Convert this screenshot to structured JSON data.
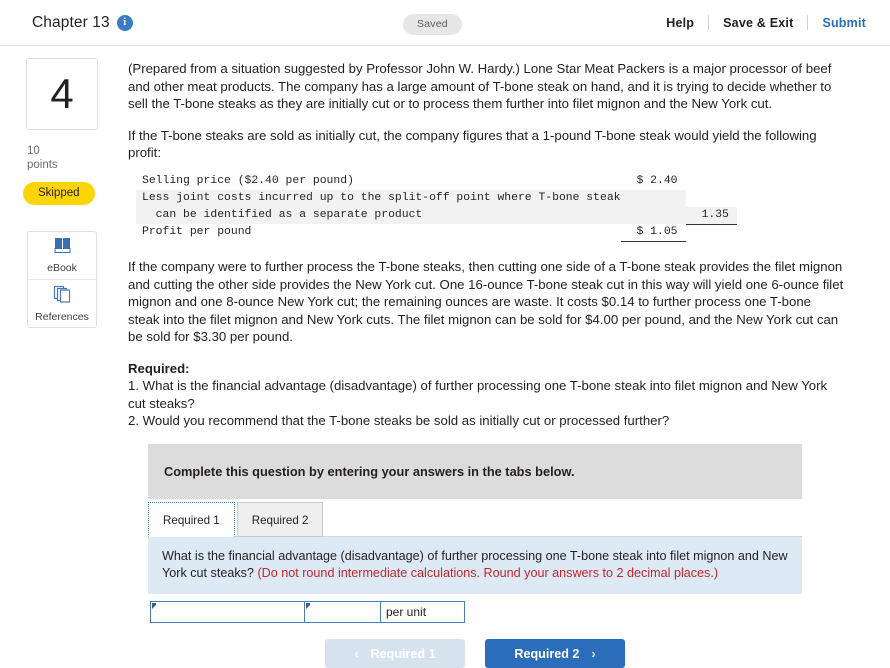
{
  "header": {
    "chapter": "Chapter 13",
    "info_icon": "info-icon",
    "status_pill": "Saved",
    "help": "Help",
    "save_exit": "Save & Exit",
    "submit": "Submit"
  },
  "sidebar": {
    "question_number": "4",
    "points_value": "10",
    "points_label": "points",
    "status_badge": "Skipped",
    "tools": [
      {
        "label": "eBook",
        "icon": "book-icon"
      },
      {
        "label": "References",
        "icon": "pages-icon"
      }
    ]
  },
  "question": {
    "para1": "(Prepared from a situation suggested by Professor John W. Hardy.) Lone Star Meat Packers is a major processor of beef and other meat products. The company has a large amount of T-bone steak on hand, and it is trying to decide whether to sell the T-bone steaks as they are initially cut or to process them further into filet mignon and the New York cut.",
    "para2": "If the T-bone steaks are sold as initially cut, the company figures that a 1-pound T-bone steak would yield the following profit:",
    "para3": "If the company were to further process the T-bone steaks, then cutting one side of a T-bone steak provides the filet mignon and cutting the other side provides the New York cut. One 16-ounce T-bone steak cut in this way will yield one 6-ounce filet mignon and one 8-ounce New York cut; the remaining ounces are waste. It costs $0.14 to further process one T-bone steak into the filet mignon and New York cuts. The filet mignon can be sold for $4.00 per pound, and the New York cut can be sold for $3.30 per pound.",
    "required_heading": "Required:",
    "requirement1": "1. What is the financial advantage (disadvantage) of further processing one T-bone steak into filet mignon and New York cut steaks?",
    "requirement2": "2. Would you recommend that the T-bone steaks be sold as initially cut or processed further?"
  },
  "profit_table": {
    "rows": [
      {
        "label": "Selling price ($2.40 per pound)",
        "label2": "",
        "value": "$ 2.40",
        "shaded": false,
        "rule": "none"
      },
      {
        "label": "Less joint costs incurred up to the split-off point where T-bone steak",
        "label2": "  can be identified as a separate product",
        "value": "1.35",
        "shaded": true,
        "rule": "single"
      },
      {
        "label": "Profit per pound",
        "label2": "",
        "value": "$ 1.05",
        "shaded": false,
        "rule": "single"
      }
    ]
  },
  "answer_area": {
    "complete_bar": "Complete this question by entering your answers in the tabs below.",
    "tabs": [
      {
        "label": "Required 1",
        "active": true
      },
      {
        "label": "Required 2",
        "active": false
      }
    ],
    "prompt_text": "What is the financial advantage (disadvantage) of further processing one T-bone steak into filet mignon and New York cut steaks? ",
    "prompt_note": "(Do not round intermediate calculations. Round your answers to 2 decimal places.)",
    "field1_value": "",
    "field2_value": "",
    "unit_label": "per unit",
    "prev_button": "Required 1",
    "next_button": "Required 2",
    "prev_chevron": "‹",
    "next_chevron": "›"
  },
  "colors": {
    "accent_blue": "#2a6ebb",
    "badge_yellow": "#fdd504",
    "panel_blue": "#ddeaf6",
    "note_red": "#c1272d",
    "bar_gray": "#dcdcdc"
  }
}
